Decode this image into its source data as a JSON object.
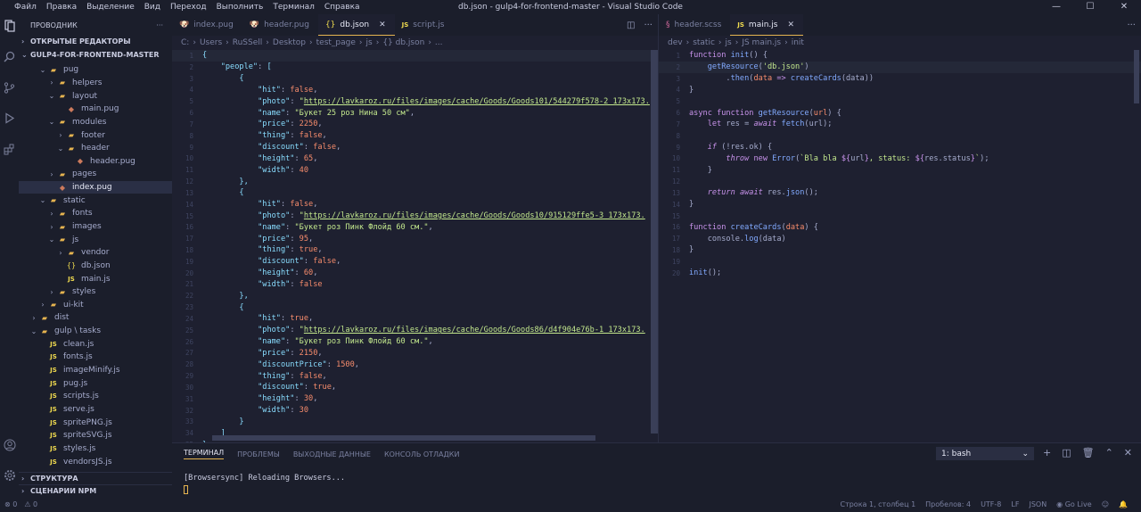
{
  "titlebar": {
    "menu": [
      "Файл",
      "Правка",
      "Выделение",
      "Вид",
      "Переход",
      "Выполнить",
      "Терминал",
      "Справка"
    ],
    "title": "db.json - gulp4-for-frontend-master - Visual Studio Code",
    "controls": [
      "—",
      "☐",
      "✕"
    ]
  },
  "sidebar": {
    "header": "ПРОВОДНИК",
    "open_editors": "ОТКРЫТЫЕ РЕДАКТОРЫ",
    "project": "GULP4-FOR-FRONTEND-MASTER",
    "tree": [
      {
        "label": "pug",
        "type": "folder",
        "depth": 1,
        "open": true
      },
      {
        "label": "helpers",
        "type": "folder",
        "depth": 2,
        "open": false
      },
      {
        "label": "layout",
        "type": "folder",
        "depth": 2,
        "open": true
      },
      {
        "label": "main.pug",
        "type": "pug",
        "depth": 3
      },
      {
        "label": "modules",
        "type": "folder",
        "depth": 2,
        "open": true
      },
      {
        "label": "footer",
        "type": "folder",
        "depth": 3,
        "open": false
      },
      {
        "label": "header",
        "type": "folder",
        "depth": 3,
        "open": true
      },
      {
        "label": "header.pug",
        "type": "pug",
        "depth": 4
      },
      {
        "label": "pages",
        "type": "folder",
        "depth": 2,
        "open": false
      },
      {
        "label": "index.pug",
        "type": "pug",
        "depth": 2,
        "active": true
      },
      {
        "label": "static",
        "type": "folder",
        "depth": 1,
        "open": true
      },
      {
        "label": "fonts",
        "type": "folder",
        "depth": 2,
        "open": false
      },
      {
        "label": "images",
        "type": "folder",
        "depth": 2,
        "open": false
      },
      {
        "label": "js",
        "type": "folder",
        "depth": 2,
        "open": true
      },
      {
        "label": "vendor",
        "type": "folder",
        "depth": 3,
        "open": false
      },
      {
        "label": "db.json",
        "type": "json",
        "depth": 3
      },
      {
        "label": "main.js",
        "type": "js",
        "depth": 3
      },
      {
        "label": "styles",
        "type": "folder",
        "depth": 2,
        "open": false
      },
      {
        "label": "ui-kit",
        "type": "folder",
        "depth": 1,
        "open": false
      },
      {
        "label": "dist",
        "type": "folder",
        "depth": 0,
        "open": false
      },
      {
        "label": "gulp \\ tasks",
        "type": "folder",
        "depth": 0,
        "open": true
      },
      {
        "label": "clean.js",
        "type": "js",
        "depth": 1
      },
      {
        "label": "fonts.js",
        "type": "js",
        "depth": 1
      },
      {
        "label": "imageMinify.js",
        "type": "js",
        "depth": 1
      },
      {
        "label": "pug.js",
        "type": "js",
        "depth": 1
      },
      {
        "label": "scripts.js",
        "type": "js",
        "depth": 1
      },
      {
        "label": "serve.js",
        "type": "js",
        "depth": 1
      },
      {
        "label": "spritePNG.js",
        "type": "js",
        "depth": 1
      },
      {
        "label": "spriteSVG.js",
        "type": "js",
        "depth": 1
      },
      {
        "label": "styles.js",
        "type": "js",
        "depth": 1
      },
      {
        "label": "vendorsJS.js",
        "type": "js",
        "depth": 1
      }
    ],
    "outline": "СТРУКТУРА",
    "npm": "СЦЕНАРИИ NPM"
  },
  "editor1": {
    "tabs": [
      {
        "label": "index.pug",
        "icon": "pug"
      },
      {
        "label": "header.pug",
        "icon": "pug"
      },
      {
        "label": "db.json",
        "icon": "json",
        "active": true
      },
      {
        "label": "script.js",
        "icon": "js"
      }
    ],
    "breadcrumb": [
      "C:",
      "Users",
      "RuSSell",
      "Desktop",
      "test_page",
      "js",
      "{} db.json",
      "..."
    ]
  },
  "editor2": {
    "tabs": [
      {
        "label": "header.scss",
        "icon": "scss"
      },
      {
        "label": "main.js",
        "icon": "js",
        "active": true
      }
    ],
    "breadcrumb": [
      "dev",
      "static",
      "js",
      "JS main.js",
      "init"
    ]
  },
  "panel": {
    "tabs": [
      "ТЕРМИНАЛ",
      "ПРОБЛЕМЫ",
      "ВЫХОДНЫЕ ДАННЫЕ",
      "КОНСОЛЬ ОТЛАДКИ"
    ],
    "terminal_select": "1: bash",
    "output_prefix": "[Browsersync]",
    "output_text": " Reloading Browsers..."
  },
  "status": {
    "errors": "⊗ 0",
    "warnings": "⚠ 0",
    "position": "Строка 1, столбец 1",
    "spaces": "Пробелов: 4",
    "encoding": "UTF-8",
    "eol": "LF",
    "language": "JSON",
    "golive": "Go Live"
  }
}
